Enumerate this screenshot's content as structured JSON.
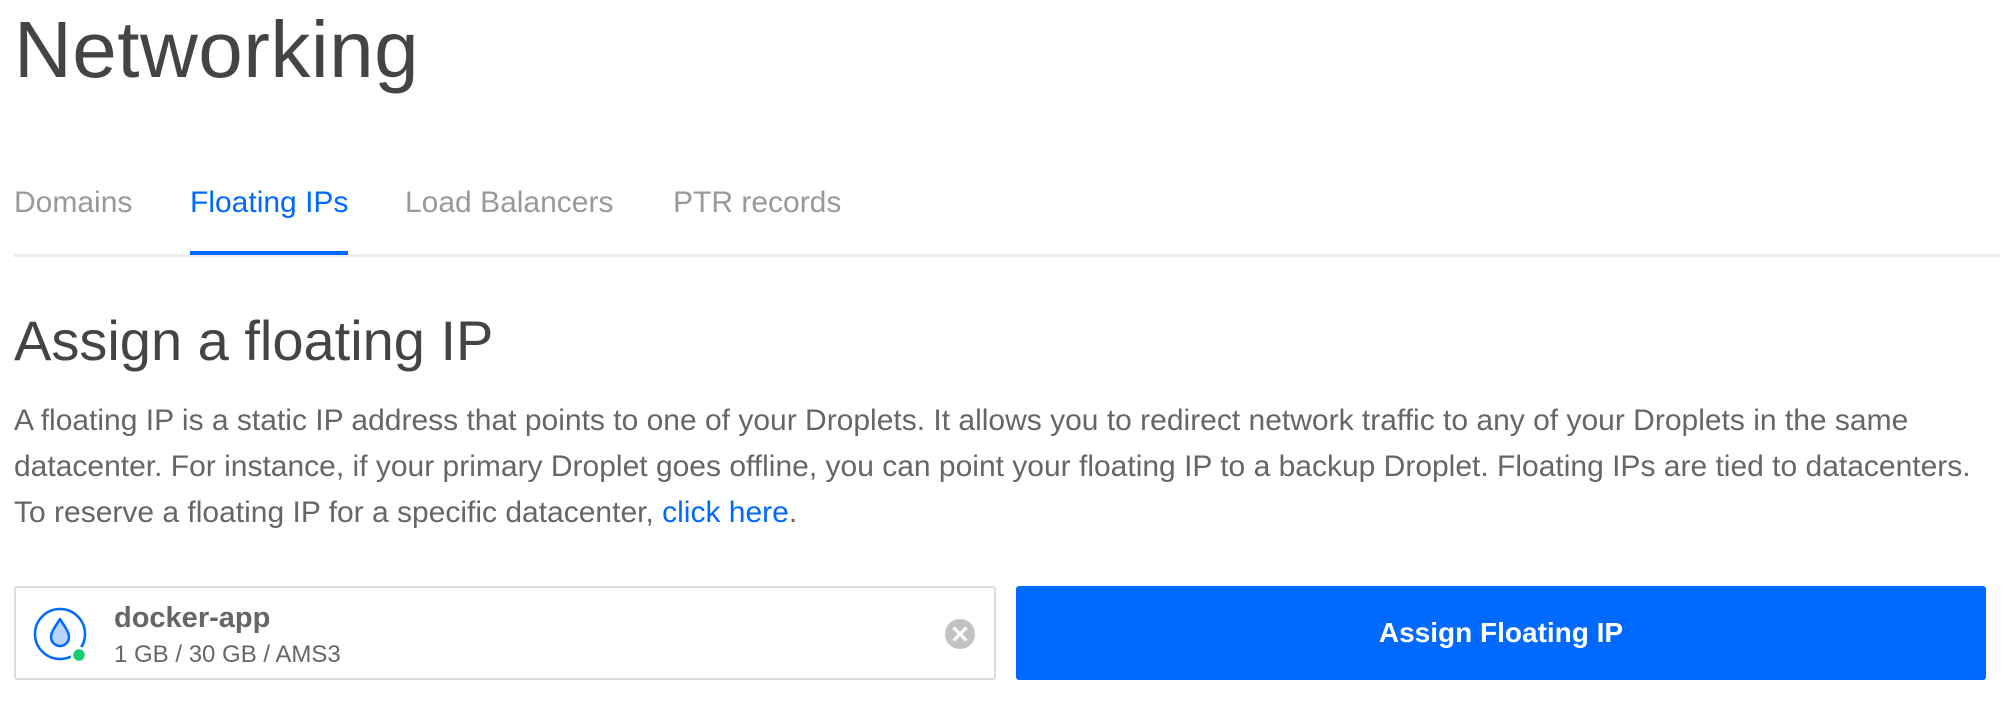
{
  "page": {
    "title": "Networking"
  },
  "tabs": [
    {
      "label": "Domains",
      "active": false
    },
    {
      "label": "Floating IPs",
      "active": true
    },
    {
      "label": "Load Balancers",
      "active": false
    },
    {
      "label": "PTR records",
      "active": false
    }
  ],
  "assign": {
    "title": "Assign a floating IP",
    "description_main": "A floating IP is a static IP address that points to one of your Droplets. It allows you to redirect network traffic to any of your Droplets in the same datacenter. For instance, if your primary Droplet goes offline, you can point your floating IP to a backup Droplet. Floating IPs are tied to datacenters. To reserve a floating IP for a specific datacenter, ",
    "link_label": "click here",
    "description_end": ".",
    "droplet": {
      "name": "docker-app",
      "meta": "1 GB / 30 GB / AMS3",
      "status": "active",
      "icon": "droplet-icon",
      "clear_icon": "clear-icon"
    },
    "button_label": "Assign Floating IP"
  },
  "colors": {
    "accent": "#0069ff",
    "status_active": "#15cd72",
    "text": "#444444",
    "muted": "#999999",
    "border": "#dcdcdc"
  }
}
